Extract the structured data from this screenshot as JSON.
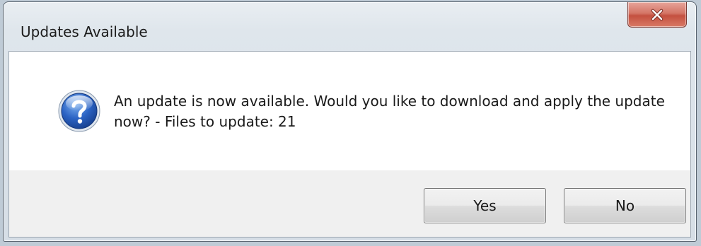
{
  "dialog": {
    "title": "Updates Available",
    "message": "An update is now available. Would you like to download and apply the update now? - Files to update: 21",
    "icon": "question-icon",
    "buttons": {
      "yes_label": "Yes",
      "no_label": "No"
    },
    "close_icon": "close-icon"
  },
  "colors": {
    "close_button": "#c4503f",
    "icon_blue": "#1f4fa8",
    "content_background": "#ffffff",
    "button_row_background": "#f0f0f0"
  }
}
